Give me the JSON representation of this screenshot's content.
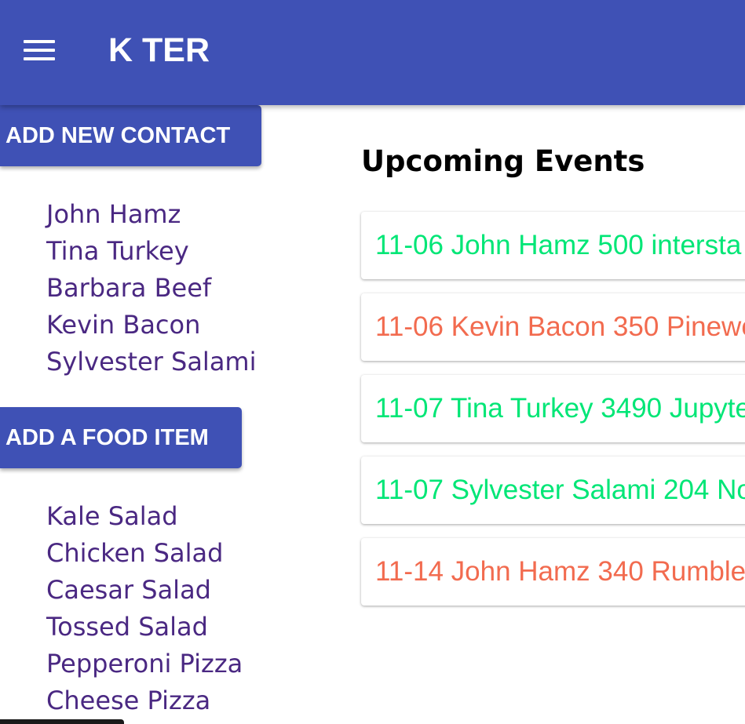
{
  "app": {
    "title": "K TER"
  },
  "contacts": {
    "button_label": "ADD NEW CONTACT",
    "items": [
      "John Hamz",
      "Tina Turkey",
      "Barbara Beef",
      "Kevin Bacon",
      "Sylvester Salami"
    ]
  },
  "foods": {
    "button_label": "ADD A FOOD ITEM",
    "items": [
      "Kale Salad",
      "Chicken Salad",
      "Caesar Salad",
      "Tossed Salad",
      "Pepperoni Pizza",
      "Cheese Pizza"
    ]
  },
  "events": {
    "heading": "Upcoming Events",
    "items": [
      {
        "text": "11-06 John Hamz 500 intersta",
        "color": "#00e676"
      },
      {
        "text": "11-06 Kevin Bacon 350 Pinewo",
        "color": "#f26b4f"
      },
      {
        "text": "11-07 Tina Turkey 3490 Jupyte",
        "color": "#00e676"
      },
      {
        "text": "11-07 Sylvester Salami 204 No",
        "color": "#00e676"
      },
      {
        "text": "11-14 John Hamz 340 Rumble",
        "color": "#f26b4f"
      }
    ]
  },
  "colors": {
    "primary": "#3f51b5",
    "list_text": "#4a2882",
    "event_confirmed": "#00e676",
    "event_pending": "#f26b4f"
  },
  "icons": {
    "menu": "hamburger-menu-icon"
  }
}
